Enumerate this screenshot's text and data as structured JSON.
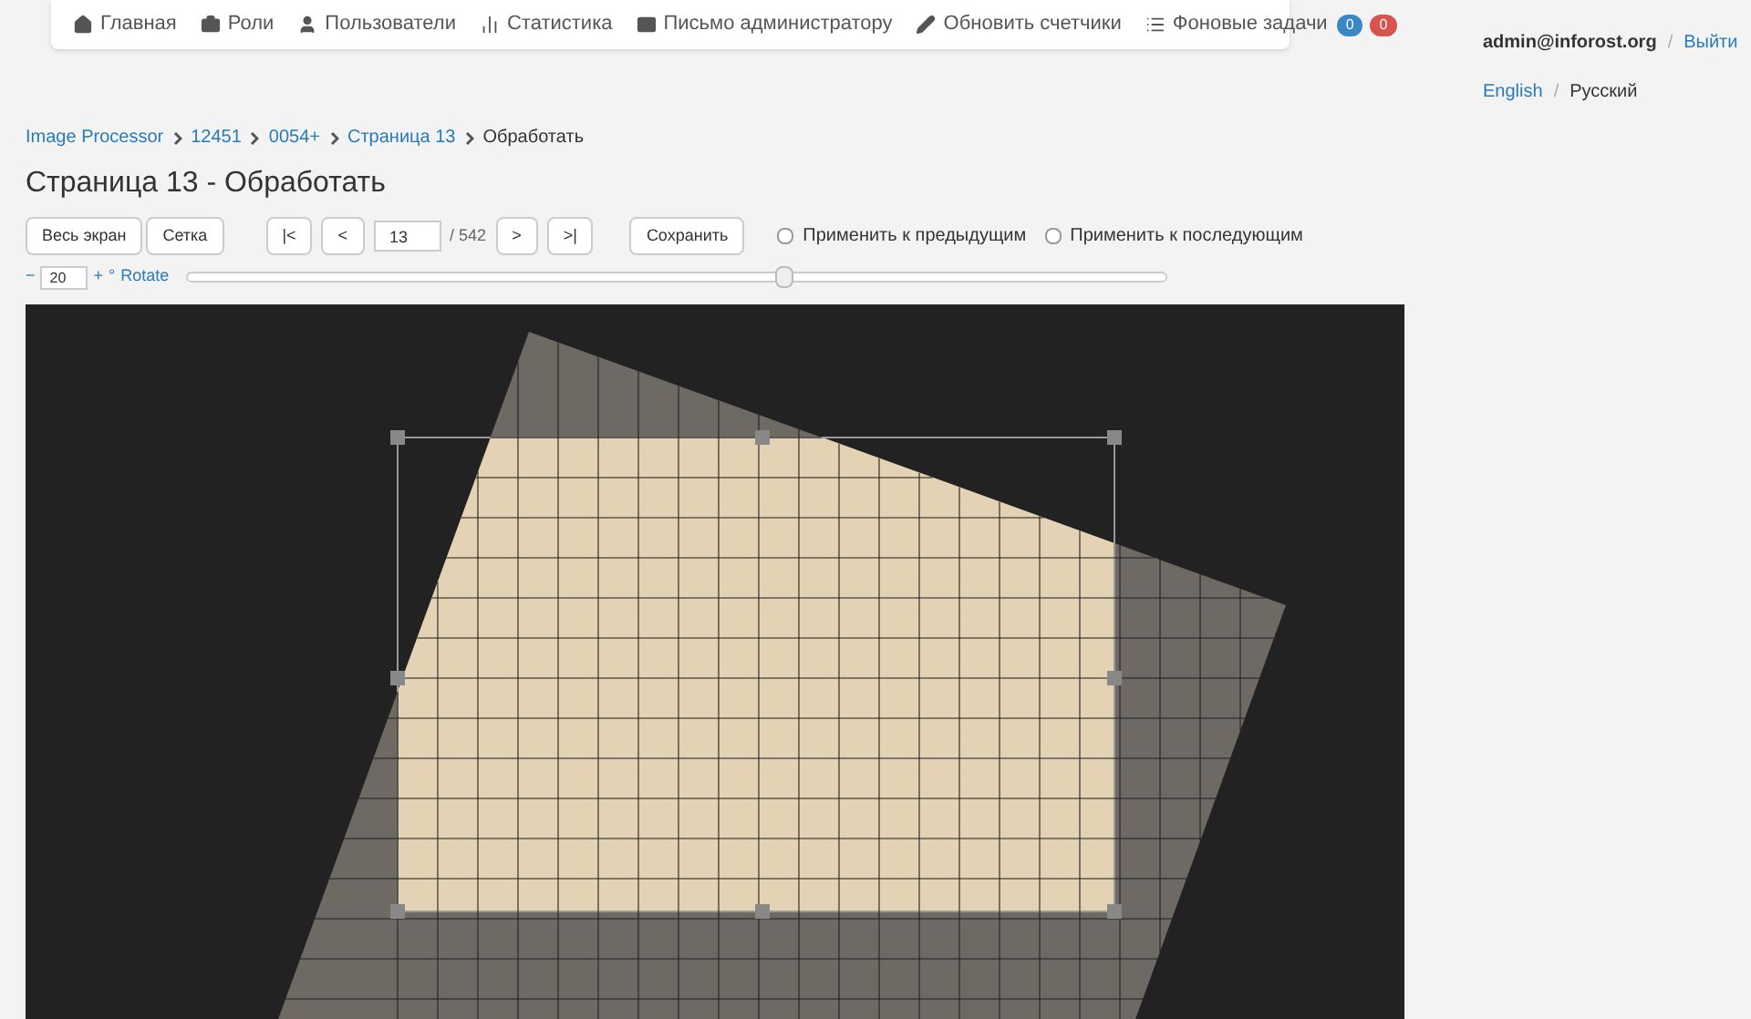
{
  "nav": {
    "items": [
      {
        "label": "Главная"
      },
      {
        "label": "Роли"
      },
      {
        "label": "Пользователи"
      },
      {
        "label": "Статистика"
      },
      {
        "label": "Письмо администратору"
      },
      {
        "label": "Обновить счетчики"
      },
      {
        "label": "Фоновые задачи"
      }
    ],
    "badges": [
      {
        "text": "0",
        "color": "#3a87c8"
      },
      {
        "text": "0",
        "color": "#d9534f"
      }
    ]
  },
  "account": {
    "user": "admin@inforost.org",
    "separator": "/",
    "logout": "Выйти",
    "language_separator": "/",
    "languages": [
      {
        "label": "English",
        "selected": false
      },
      {
        "label": "Русский",
        "selected": true
      }
    ]
  },
  "breadcrumbs": [
    "Image Processor",
    "12451",
    "0054+",
    "Страница 13",
    "Обработать"
  ],
  "title": "Страница 13 - Обработать",
  "toolbar": {
    "view_buttons": [
      "Весь экран",
      "Сетка"
    ],
    "first": "|<",
    "prev": "<",
    "page": "13",
    "total": "/ 542",
    "next": ">",
    "last": ">|",
    "save": "Сохранить",
    "options": [
      {
        "label": "Применить к предыдущим",
        "checked": false
      },
      {
        "label": "Применить к последующим",
        "checked": false
      }
    ]
  },
  "rotate": {
    "minus": "−",
    "value": "20",
    "plus": "+",
    "degree": "°",
    "label": "Rotate",
    "level": 0.61
  }
}
